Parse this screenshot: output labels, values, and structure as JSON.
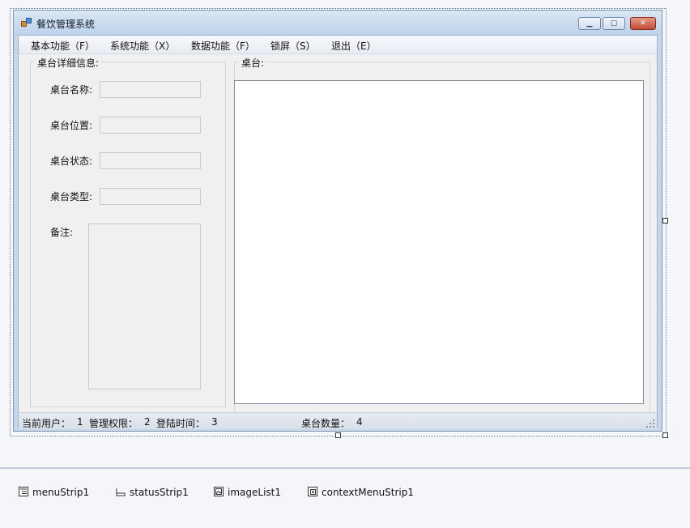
{
  "window": {
    "title": "餐饮管理系统",
    "controls": {
      "minimize": "▁",
      "maximize": "▢",
      "close": "✕"
    }
  },
  "menu": [
    {
      "label": "基本功能（F）"
    },
    {
      "label": "系统功能（X）"
    },
    {
      "label": "数据功能（F）"
    },
    {
      "label": "锁屏（S）"
    },
    {
      "label": "退出（E）"
    }
  ],
  "detail_group": {
    "title": "桌台详细信息:",
    "fields": [
      {
        "label": "桌台名称:",
        "value": ""
      },
      {
        "label": "桌台位置:",
        "value": ""
      },
      {
        "label": "桌台状态:",
        "value": ""
      },
      {
        "label": "桌台类型:",
        "value": ""
      }
    ],
    "notes_label": "备注:",
    "notes_value": ""
  },
  "tables_group": {
    "title": "桌台:"
  },
  "status": {
    "current_user_label": "当前用户：",
    "current_user_value": "1",
    "permission_label": "管理权限：",
    "permission_value": "2",
    "login_time_label": "登陆时间：",
    "login_time_value": "3",
    "table_count_label": "桌台数量：",
    "table_count_value": "4"
  },
  "component_tray": [
    {
      "label": "menuStrip1",
      "icon": "menu-strip-icon"
    },
    {
      "label": "statusStrip1",
      "icon": "status-strip-icon"
    },
    {
      "label": "imageList1",
      "icon": "image-list-icon"
    },
    {
      "label": "contextMenuStrip1",
      "icon": "context-menu-strip-icon"
    }
  ]
}
